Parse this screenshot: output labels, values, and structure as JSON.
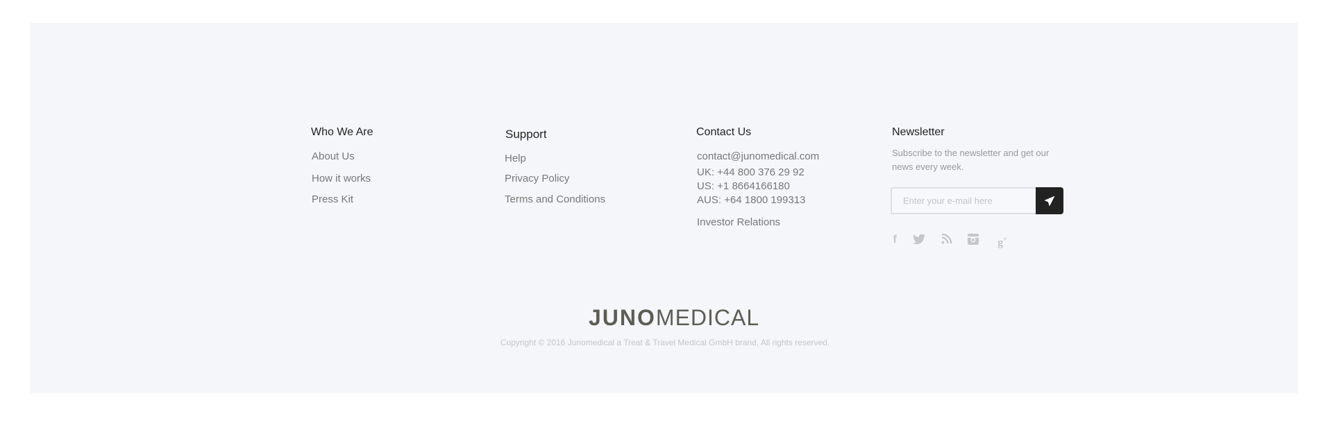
{
  "columns": [
    {
      "title": "Who We Are",
      "links": [
        "About Us",
        "How it works",
        "Press Kit"
      ]
    },
    {
      "title": "Support",
      "links": [
        "Help",
        "Privacy Policy",
        "Terms and Conditions"
      ]
    },
    {
      "title": "Contact Us",
      "email": "contact@junomedical.com",
      "phones": [
        "UK: +44 800 376 29 92",
        "US: +1 8664166180",
        "AUS: +64 1800 199313"
      ],
      "link": "Investor Relations"
    }
  ],
  "newsletter": {
    "title": "Newsletter",
    "description": "Subscribe to the newsletter and get our news every week.",
    "placeholder": "Enter your e-mail here",
    "submit_icon": "paper-plane-icon"
  },
  "social": [
    "facebook-icon",
    "twitter-icon",
    "rss-icon",
    "instagram-icon",
    "google-plus-icon"
  ],
  "logo": {
    "part1": "JUNO",
    "part2": "MEDICAL"
  },
  "copyright": "Copyright © 2016 Junomedical a Treat & Travel Medical GmbH brand, All rights reserved.",
  "colors": {
    "background": "#f5f6fa",
    "button": "#222222"
  }
}
